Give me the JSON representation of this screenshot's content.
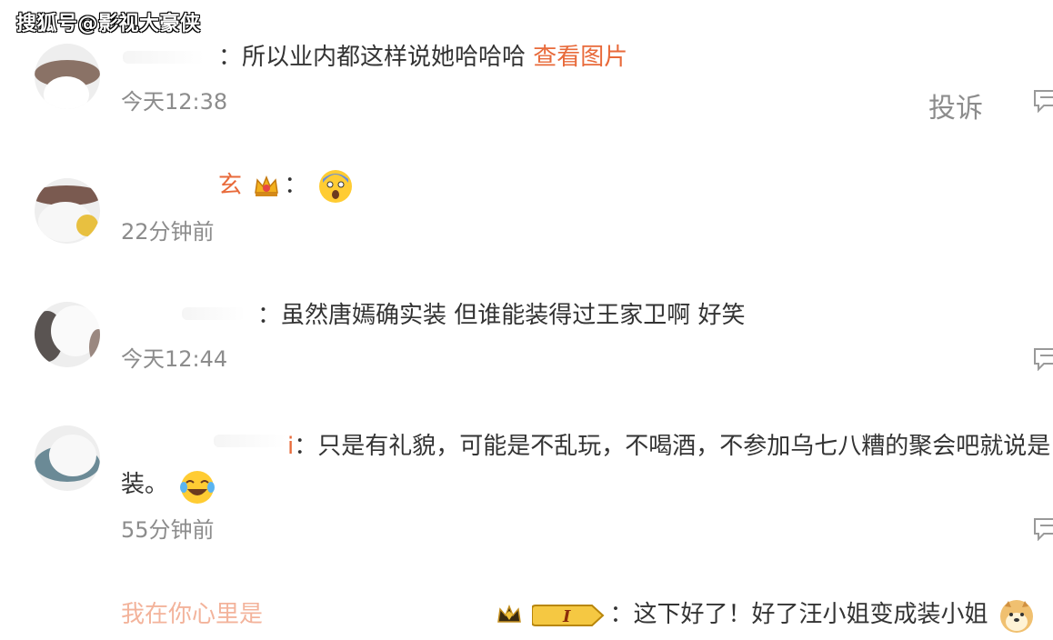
{
  "watermark": "搜狐号@影视大豪侠",
  "report_label": "投诉",
  "comments": [
    {
      "text_prefix": "：所以业内都这样说她哈哈哈 ",
      "link": "查看图片",
      "time": "今天12:38"
    },
    {
      "name_fragment": "玄",
      "text_prefix": "：",
      "emoji": "scream-emoji",
      "badge": "crown-badge",
      "time": "22分钟前"
    },
    {
      "text_prefix": "：虽然唐嫣确实装 但谁能装得过王家卫啊 好笑",
      "time": "今天12:44"
    },
    {
      "name_fragment": "i",
      "text_prefix": "：只是有礼貌，可能是不乱玩，不喝酒，不参加乌七八糟的聚会吧就说是",
      "text_line2": "装。",
      "emoji": "laugh-cry-emoji",
      "time": "55分钟前"
    },
    {
      "name_fragment": "我在你心里是",
      "text_prefix": "：这下好了！好了汪小姐变成装小姐",
      "badge": "vip-badge",
      "emoji": "doge-emoji"
    }
  ]
}
